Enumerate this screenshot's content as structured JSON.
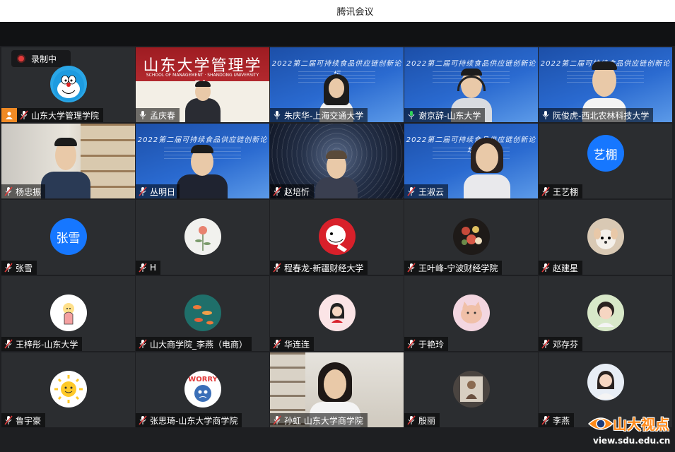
{
  "window": {
    "title": "腾讯会议"
  },
  "recording": {
    "label": "录制中"
  },
  "forum_banner": "2022第二届可持续食品供应链创新论坛",
  "school_banner": {
    "title": "山东大学管理学院",
    "subtitle": "SCHOOL OF MANAGEMENT · SHANDONG UNIVERSITY"
  },
  "participants": [
    {
      "name": "山东大学管理学院",
      "mic": "muted",
      "host": true
    },
    {
      "name": "孟庆春",
      "mic": "on"
    },
    {
      "name": "朱庆华-上海交通大学",
      "mic": "on"
    },
    {
      "name": "谢京辞-山东大学",
      "mic": "speaking",
      "active": true
    },
    {
      "name": "阮俊虎-西北农林科技大学",
      "mic": "on"
    },
    {
      "name": "杨忠振",
      "mic": "muted"
    },
    {
      "name": "丛明日",
      "mic": "muted"
    },
    {
      "name": "赵培忻",
      "mic": "muted"
    },
    {
      "name": "王淑云",
      "mic": "muted"
    },
    {
      "name": "王艺棚",
      "mic": "muted",
      "avatar_text": "艺棚"
    },
    {
      "name": "张雪",
      "mic": "muted",
      "avatar_text": "张雪"
    },
    {
      "name": "H",
      "mic": "muted"
    },
    {
      "name": "程春龙-新疆财经大学",
      "mic": "muted"
    },
    {
      "name": "王叶峰-宁波财经学院",
      "mic": "muted"
    },
    {
      "name": "赵建星",
      "mic": "muted"
    },
    {
      "name": "王梓彤-山东大学",
      "mic": "muted"
    },
    {
      "name": "山大商学院_李燕（电商）",
      "mic": "muted"
    },
    {
      "name": "华连连",
      "mic": "muted"
    },
    {
      "name": "于艳玲",
      "mic": "muted"
    },
    {
      "name": "邓存芬",
      "mic": "muted"
    },
    {
      "name": "鲁宇豪",
      "mic": "muted"
    },
    {
      "name": "张思琦-山东大学商学院",
      "mic": "muted"
    },
    {
      "name": "孙虹 山东大学商学院",
      "mic": "muted"
    },
    {
      "name": "殷丽",
      "mic": "muted"
    },
    {
      "name": "李燕",
      "mic": "muted"
    }
  ],
  "avatar_badges": {
    "worry": "WORRY"
  },
  "watermark": {
    "name": "山大视点",
    "url": "view.sdu.edu.cn"
  },
  "colors": {
    "speaking_green": "#30d158",
    "host_orange": "#f08a24",
    "avatar_blue": "#1677ff"
  }
}
